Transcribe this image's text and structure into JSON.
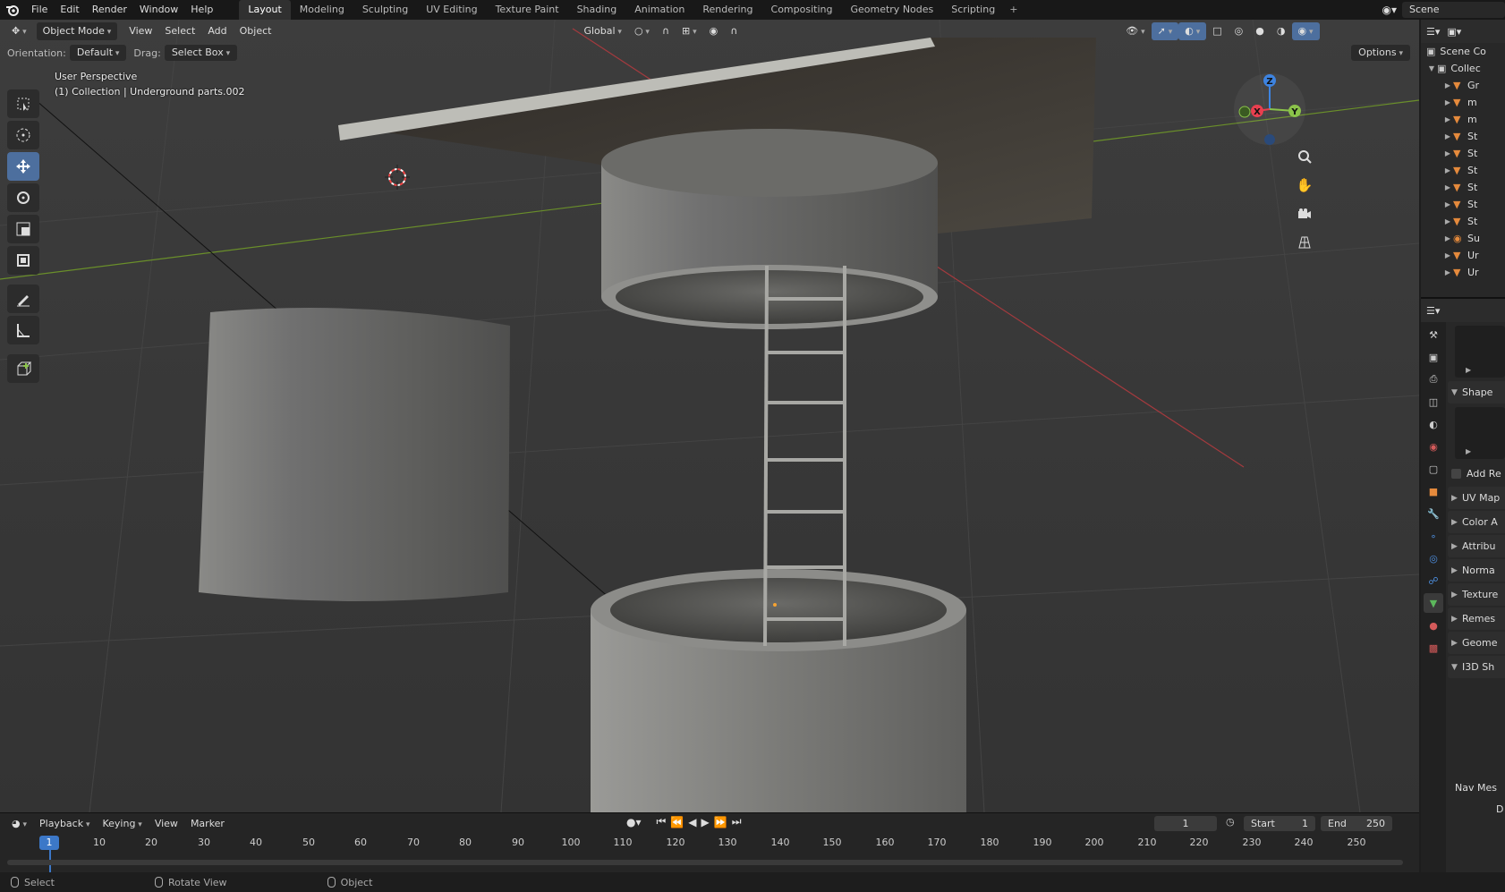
{
  "topbar": {
    "menus": [
      "File",
      "Edit",
      "Render",
      "Window",
      "Help"
    ],
    "workspaces": [
      "Layout",
      "Modeling",
      "Sculpting",
      "UV Editing",
      "Texture Paint",
      "Shading",
      "Animation",
      "Rendering",
      "Compositing",
      "Geometry Nodes",
      "Scripting"
    ],
    "active_workspace": "Layout",
    "add_tab": "+",
    "scene_name": "Scene"
  },
  "viewport_header": {
    "mode": "Object Mode",
    "menus": [
      "View",
      "Select",
      "Add",
      "Object"
    ],
    "transform_orientation": "Global",
    "options": "Options"
  },
  "tool_settings": {
    "orientation_label": "Orientation:",
    "orientation_value": "Default",
    "drag_label": "Drag:",
    "drag_value": "Select Box"
  },
  "viewport_overlay": {
    "view_name": "User Perspective",
    "active_info": "(1) Collection | Underground parts.002"
  },
  "gizmo": {
    "x": "X",
    "y": "Y",
    "z": "Z"
  },
  "timeline": {
    "menus": [
      "Playback",
      "Keying",
      "View",
      "Marker"
    ],
    "current_frame": "1",
    "start_label": "Start",
    "start_value": "1",
    "end_label": "End",
    "end_value": "250",
    "ruler": [
      "1",
      "10",
      "20",
      "30",
      "40",
      "50",
      "60",
      "70",
      "80",
      "90",
      "100",
      "110",
      "120",
      "130",
      "140",
      "150",
      "160",
      "170",
      "180",
      "190",
      "200",
      "210",
      "220",
      "230",
      "240",
      "250"
    ]
  },
  "statusbar": {
    "items": [
      "Select",
      "Rotate View",
      "Object"
    ]
  },
  "outliner": {
    "scene_collection": "Scene Co",
    "collection": "Collec",
    "items": [
      "Gr",
      "m",
      "m",
      "St",
      "St",
      "St",
      "St",
      "St",
      "St",
      "Su",
      "Ur",
      "Ur"
    ]
  },
  "properties": {
    "panels": [
      "Shape",
      "Add Re",
      "UV Map",
      "Color A",
      "Attribu",
      "Norma",
      "Texture",
      "Remes",
      "Geome",
      "I3D Sh"
    ],
    "nav_mesh": "Nav Mes",
    "footer_letter": "D"
  },
  "colors": {
    "accent": "#4d6f9e",
    "x_axis": "#e83f4f",
    "y_axis": "#8bc34a",
    "z_axis": "#3d83e0",
    "mesh_icon": "#e58a3c"
  }
}
